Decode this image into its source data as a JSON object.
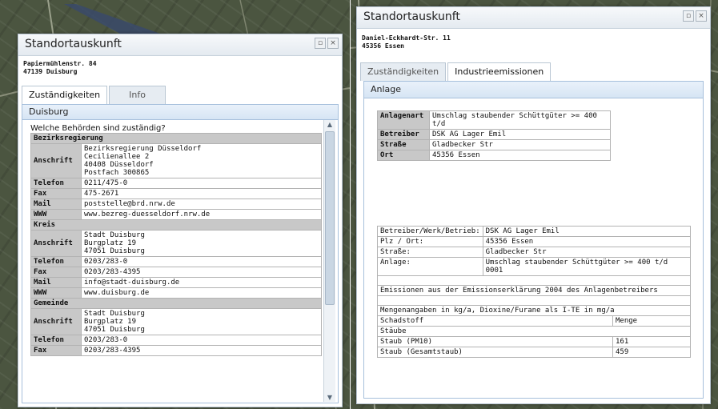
{
  "left": {
    "title": "Standortauskunft",
    "address": [
      "Papiermühlenstr. 84",
      "47139 Duisburg"
    ],
    "tabs": [
      {
        "label": "Zuständigkeiten"
      },
      {
        "label": "Info"
      }
    ],
    "section_title": "Duisburg",
    "question": "Welche Behörden sind zuständig?",
    "groups": [
      {
        "title": "Bezirksregierung",
        "rows": [
          {
            "label": "Anschrift",
            "value": "Bezirksregierung Düsseldorf\nCecilienallee 2\n40408 Düsseldorf\nPostfach 300865"
          },
          {
            "label": "Telefon",
            "value": "0211/475-0"
          },
          {
            "label": "Fax",
            "value": "475-2671"
          },
          {
            "label": "Mail",
            "value": "poststelle@brd.nrw.de"
          },
          {
            "label": "WWW",
            "value": "www.bezreg-duesseldorf.nrw.de"
          }
        ]
      },
      {
        "title": "Kreis",
        "rows": [
          {
            "label": "Anschrift",
            "value": "Stadt Duisburg\nBurgplatz 19\n47051 Duisburg"
          },
          {
            "label": "Telefon",
            "value": "0203/283-0"
          },
          {
            "label": "Fax",
            "value": "0203/283-4395"
          },
          {
            "label": "Mail",
            "value": "info@stadt-duisburg.de"
          },
          {
            "label": "WWW",
            "value": "www.duisburg.de"
          }
        ]
      },
      {
        "title": "Gemeinde",
        "rows": [
          {
            "label": "Anschrift",
            "value": "Stadt Duisburg\nBurgplatz 19\n47051 Duisburg"
          },
          {
            "label": "Telefon",
            "value": "0203/283-0"
          },
          {
            "label": "Fax",
            "value": "0203/283-4395"
          }
        ]
      }
    ]
  },
  "right": {
    "title": "Standortauskunft",
    "address": [
      "Daniel-Eckhardt-Str. 11",
      "45356 Essen"
    ],
    "tabs": [
      {
        "label": "Zuständigkeiten"
      },
      {
        "label": "Industrieemissionen"
      }
    ],
    "section_title": "Anlage",
    "summary": [
      {
        "label": "Anlagenart",
        "value": "Umschlag staubender Schüttgüter >= 400 t/d"
      },
      {
        "label": "Betreiber",
        "value": "DSK AG Lager Emil"
      },
      {
        "label": "Straße",
        "value": "Gladbecker Str"
      },
      {
        "label": "Ort",
        "value": "45356 Essen"
      }
    ],
    "details": [
      {
        "label": "Betreiber/Werk/Betrieb:",
        "value": "DSK AG Lager Emil"
      },
      {
        "label": "Plz / Ort:",
        "value": "45356 Essen"
      },
      {
        "label": "Straße:",
        "value": "Gladbecker Str"
      },
      {
        "label": "Anlage:",
        "value": "Umschlag staubender Schüttgüter >= 400 t/d 0001"
      }
    ],
    "emissions_note": "Emissionen aus der Emissionserklärung 2004 des Anlagenbetreibers",
    "units_note": "Mengenangaben in kg/a, Dioxine/Furane als I-TE in mg/a",
    "emissions_header": {
      "substance": "Schadstoff",
      "amount": "Menge"
    },
    "emissions_group": "Stäube",
    "emissions": [
      {
        "substance": "Staub (PM10)",
        "amount": "161"
      },
      {
        "substance": "Staub (Gesamtstaub)",
        "amount": "459"
      }
    ]
  }
}
